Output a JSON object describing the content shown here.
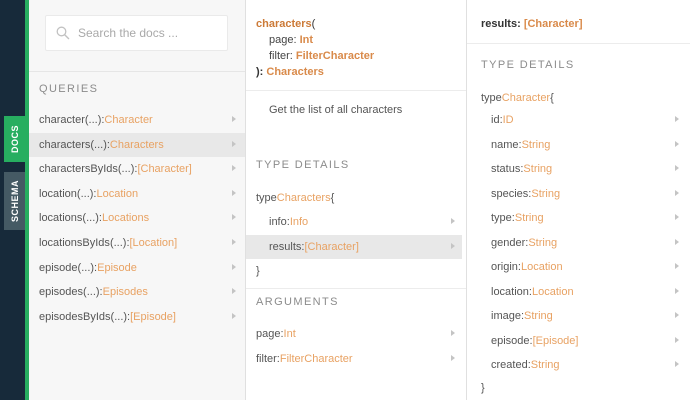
{
  "sidebar_tabs": {
    "docs": "DOCS",
    "schema": "SCHEMA"
  },
  "search": {
    "placeholder": "Search the docs ..."
  },
  "queries": {
    "title": "QUERIES",
    "items": [
      {
        "name": "character",
        "args": "(...)",
        "sep": ": ",
        "type": "Character",
        "active": false
      },
      {
        "name": "characters",
        "args": "(...)",
        "sep": ": ",
        "type": "Characters",
        "active": true
      },
      {
        "name": "charactersByIds",
        "args": "(...)",
        "sep": ": ",
        "type": "[Character]",
        "active": false
      },
      {
        "name": "location",
        "args": "(...)",
        "sep": ": ",
        "type": "Location",
        "active": false
      },
      {
        "name": "locations",
        "args": "(...)",
        "sep": ": ",
        "type": "Locations",
        "active": false
      },
      {
        "name": "locationsByIds",
        "args": "(...)",
        "sep": ": ",
        "type": "[Location]",
        "active": false
      },
      {
        "name": "episode",
        "args": "(...)",
        "sep": ": ",
        "type": "Episode",
        "active": false
      },
      {
        "name": "episodes",
        "args": "(...)",
        "sep": ": ",
        "type": "Episodes",
        "active": false
      },
      {
        "name": "episodesByIds",
        "args": "(...)",
        "sep": ": ",
        "type": "[Episode]",
        "active": false
      }
    ]
  },
  "field_detail": {
    "signature": {
      "fn": "characters",
      "open": "(",
      "args": [
        {
          "name": "page",
          "sep": ": ",
          "type": "Int"
        },
        {
          "name": "filter",
          "sep": ": ",
          "type": "FilterCharacter"
        }
      ],
      "close": "): ",
      "return_type": "Characters"
    },
    "description": "Get the list of all characters",
    "type_details_title": "TYPE DETAILS",
    "type_open_keyword": "type ",
    "type_name": "Characters",
    "type_open_brace": " {",
    "fields": [
      {
        "name": "info",
        "sep": ": ",
        "type": "Info",
        "active": false
      },
      {
        "name": "results",
        "sep": ": ",
        "type": "[Character]",
        "active": true
      }
    ],
    "type_close": "}",
    "arguments_title": "ARGUMENTS",
    "arguments": [
      {
        "name": "page",
        "sep": ": ",
        "type": "Int"
      },
      {
        "name": "filter",
        "sep": ": ",
        "type": "FilterCharacter"
      }
    ]
  },
  "type_detail": {
    "header": {
      "name": "results",
      "sep": ": ",
      "type": "[Character]"
    },
    "type_details_title": "TYPE DETAILS",
    "type_open_keyword": "type ",
    "type_name": "Character",
    "type_open_brace": " {",
    "fields": [
      {
        "name": "id",
        "sep": ": ",
        "type": "ID"
      },
      {
        "name": "name",
        "sep": ": ",
        "type": "String"
      },
      {
        "name": "status",
        "sep": ": ",
        "type": "String"
      },
      {
        "name": "species",
        "sep": ": ",
        "type": "String"
      },
      {
        "name": "type",
        "sep": ": ",
        "type": "String"
      },
      {
        "name": "gender",
        "sep": ": ",
        "type": "String"
      },
      {
        "name": "origin",
        "sep": ": ",
        "type": "Location"
      },
      {
        "name": "location",
        "sep": ": ",
        "type": "Location"
      },
      {
        "name": "image",
        "sep": ": ",
        "type": "String"
      },
      {
        "name": "episode",
        "sep": ": ",
        "type": "[Episode]"
      },
      {
        "name": "created",
        "sep": ": ",
        "type": "String"
      }
    ],
    "type_close": "}"
  },
  "colors": {
    "sidebar_bg": "#172a3a",
    "accent_green": "#27ae60",
    "schema_tab_bg": "#455a64",
    "type_orange": "#e8a263",
    "active_row_bg": "#e8e8e8"
  },
  "icons": {
    "search": "search-icon",
    "row_arrow": "chevron-right-icon"
  }
}
